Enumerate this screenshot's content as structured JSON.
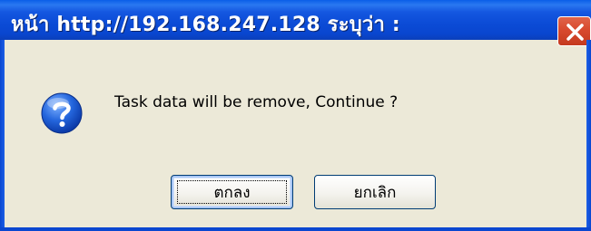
{
  "dialog": {
    "title": "หน้า http://192.168.247.128 ระบุว่า :",
    "message": "Task data will be remove, Continue ?",
    "ok_label": "ตกลง",
    "cancel_label": "ยกเลิก"
  },
  "icons": {
    "close": "close-icon",
    "question": "question-icon"
  },
  "colors": {
    "titlebar": "#0b4bd6",
    "close_button": "#d8492e",
    "dialog_background": "#ece9d8",
    "button_border": "#003c74"
  }
}
